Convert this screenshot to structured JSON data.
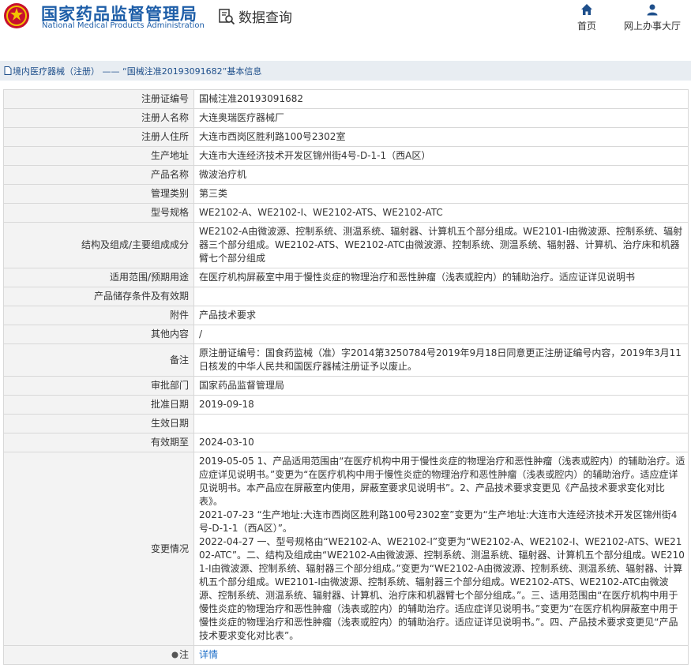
{
  "header": {
    "logo_cn": "国家药品监督管理局",
    "logo_en": "National Medical Products Administration",
    "query_label": "数据查询",
    "nav": {
      "home": "首页",
      "office": "网上办事大厅"
    }
  },
  "breadcrumb": "境内医疗器械（注册） —— “国械注准20193091682”基本信息",
  "colors": {
    "brand": "#1e5ea8",
    "header_bg": "#e8edf2",
    "key_bg": "#f3f3f3",
    "link": "#1e6fc8"
  },
  "rows": [
    {
      "key": "注册证编号",
      "value": "国械注准20193091682"
    },
    {
      "key": "注册人名称",
      "value": "大连奥瑞医疗器械厂"
    },
    {
      "key": "注册人住所",
      "value": "大连市西岗区胜利路100号2302室"
    },
    {
      "key": "生产地址",
      "value": "大连市大连经济技术开发区锦州街4号-D-1-1（西A区）"
    },
    {
      "key": "产品名称",
      "value": "微波治疗机"
    },
    {
      "key": "管理类别",
      "value": "第三类"
    },
    {
      "key": "型号规格",
      "value": "WE2102-A、WE2102-I、WE2102-ATS、WE2102-ATC"
    },
    {
      "key": "结构及组成/主要组成成分",
      "value": "WE2102-A由微波源、控制系统、测温系统、辐射器、计算机五个部分组成。WE2101-I由微波源、控制系统、辐射器三个部分组成。WE2102-ATS、WE2102-ATC由微波源、控制系统、测温系统、辐射器、计算机、治疗床和机器臂七个部分组成"
    },
    {
      "key": "适用范围/预期用途",
      "value": "在医疗机构屏蔽室中用于慢性炎症的物理治疗和恶性肿瘤（浅表或腔内）的辅助治疗。适应证详见说明书"
    },
    {
      "key": "产品储存条件及有效期",
      "value": ""
    },
    {
      "key": "附件",
      "value": "产品技术要求"
    },
    {
      "key": "其他内容",
      "value": "/"
    },
    {
      "key": "备注",
      "value": "原注册证编号：国食药监械（准）字2014第3250784号2019年9月18日同意更正注册证编号内容，2019年3月11日核发的中华人民共和国医疗器械注册证予以废止。"
    },
    {
      "key": "审批部门",
      "value": "国家药品监督管理局"
    },
    {
      "key": "批准日期",
      "value": "2019-09-18"
    },
    {
      "key": "生效日期",
      "value": ""
    },
    {
      "key": "有效期至",
      "value": "2024-03-10"
    },
    {
      "key": "变更情况",
      "value": "2019-05-05 1、产品适用范围由“在医疗机构中用于慢性炎症的物理治疗和恶性肿瘤（浅表或腔内）的辅助治疗。适应症详见说明书。”变更为“在医疗机构中用于慢性炎症的物理治疗和恶性肿瘤（浅表或腔内）的辅助治疗。适应症详见说明书。本产品应在屏蔽室内使用，屏蔽室要求见说明书”。2、产品技术要求变更见《产品技术要求变化对比表》。\n2021-07-23 “生产地址:大连市西岗区胜利路100号2302室”变更为“生产地址:大连市大连经济技术开发区锦州街4号-D-1-1（西A区）”。\n2022-04-27 一、型号规格由“WE2102-A、WE2102-I”变更为“WE2102-A、WE2102-I、WE2102-ATS、WE2102-ATC”。二、结构及组成由“WE2102-A由微波源、控制系统、测温系统、辐射器、计算机五个部分组成。WE2101-I由微波源、控制系统、辐射器三个部分组成。”变更为“WE2102-A由微波源、控制系统、测温系统、辐射器、计算机五个部分组成。WE2101-I由微波源、控制系统、辐射器三个部分组成。WE2102-ATS、WE2102-ATC由微波源、控制系统、测温系统、辐射器、计算机、治疗床和机器臂七个部分组成。”。三、适用范围由“在医疗机构中用于慢性炎症的物理治疗和恶性肿瘤（浅表或腔内）的辅助治疗。适应症详见说明书。”变更为“在医疗机构屏蔽室中用于慢性炎症的物理治疗和恶性肿瘤（浅表或腔内）的辅助治疗。适应证详见说明书。”。四、产品技术要求变更见“产品技术要求变化对比表”。"
    }
  ],
  "note": {
    "key": "注",
    "link": "详情"
  }
}
